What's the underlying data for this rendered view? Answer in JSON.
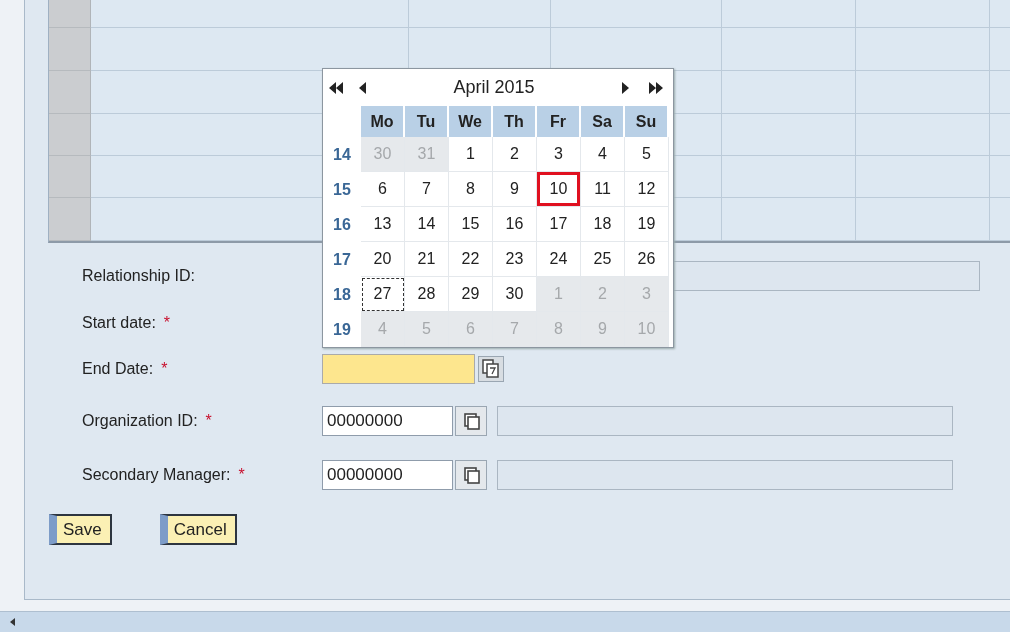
{
  "form": {
    "rows": [
      {
        "label": "Relationship ID:",
        "field": {
          "kind": "readonly"
        }
      },
      {
        "label": "Start date:",
        "required_mark": "*"
      },
      {
        "label": "End Date:",
        "required_mark": "*",
        "field": {
          "kind": "date"
        }
      },
      {
        "label": "Organization ID:",
        "required_mark": "*",
        "field": {
          "kind": "lookup",
          "value": "00000000"
        }
      },
      {
        "label": "Secondary Manager:",
        "required_mark": "*",
        "field": {
          "kind": "lookup",
          "value": "00000000"
        }
      }
    ],
    "buttons": [
      "Save",
      "Cancel"
    ]
  },
  "date_picker": {
    "title": "April 2015",
    "weekdays": [
      "Mo",
      "Tu",
      "We",
      "Th",
      "Fr",
      "Sa",
      "Su"
    ],
    "weeks": [
      {
        "number": "14",
        "days": [
          {
            "label": "30",
            "outside": true,
            "selected": false,
            "today": false
          },
          {
            "label": "31",
            "outside": true,
            "selected": false,
            "today": false
          },
          {
            "label": "1",
            "outside": false,
            "selected": false,
            "today": false
          },
          {
            "label": "2",
            "outside": false,
            "selected": false,
            "today": false
          },
          {
            "label": "3",
            "outside": false,
            "selected": false,
            "today": false
          },
          {
            "label": "4",
            "outside": false,
            "selected": false,
            "today": false
          },
          {
            "label": "5",
            "outside": false,
            "selected": false,
            "today": false
          }
        ]
      },
      {
        "number": "15",
        "days": [
          {
            "label": "6",
            "outside": false,
            "selected": false,
            "today": false
          },
          {
            "label": "7",
            "outside": false,
            "selected": false,
            "today": false
          },
          {
            "label": "8",
            "outside": false,
            "selected": false,
            "today": false
          },
          {
            "label": "9",
            "outside": false,
            "selected": false,
            "today": false
          },
          {
            "label": "10",
            "outside": false,
            "selected": true,
            "today": false
          },
          {
            "label": "11",
            "outside": false,
            "selected": false,
            "today": false
          },
          {
            "label": "12",
            "outside": false,
            "selected": false,
            "today": false
          }
        ]
      },
      {
        "number": "16",
        "days": [
          {
            "label": "13",
            "outside": false,
            "selected": false,
            "today": false
          },
          {
            "label": "14",
            "outside": false,
            "selected": false,
            "today": false
          },
          {
            "label": "15",
            "outside": false,
            "selected": false,
            "today": false
          },
          {
            "label": "16",
            "outside": false,
            "selected": false,
            "today": false
          },
          {
            "label": "17",
            "outside": false,
            "selected": false,
            "today": false
          },
          {
            "label": "18",
            "outside": false,
            "selected": false,
            "today": false
          },
          {
            "label": "19",
            "outside": false,
            "selected": false,
            "today": false
          }
        ]
      },
      {
        "number": "17",
        "days": [
          {
            "label": "20",
            "outside": false,
            "selected": false,
            "today": false
          },
          {
            "label": "21",
            "outside": false,
            "selected": false,
            "today": false
          },
          {
            "label": "22",
            "outside": false,
            "selected": false,
            "today": false
          },
          {
            "label": "23",
            "outside": false,
            "selected": false,
            "today": false
          },
          {
            "label": "24",
            "outside": false,
            "selected": false,
            "today": false
          },
          {
            "label": "25",
            "outside": false,
            "selected": false,
            "today": false
          },
          {
            "label": "26",
            "outside": false,
            "selected": false,
            "today": false
          }
        ]
      },
      {
        "number": "18",
        "days": [
          {
            "label": "27",
            "outside": false,
            "selected": false,
            "today": true
          },
          {
            "label": "28",
            "outside": false,
            "selected": false,
            "today": false
          },
          {
            "label": "29",
            "outside": false,
            "selected": false,
            "today": false
          },
          {
            "label": "30",
            "outside": false,
            "selected": false,
            "today": false
          },
          {
            "label": "1",
            "outside": true,
            "selected": false,
            "today": false
          },
          {
            "label": "2",
            "outside": true,
            "selected": false,
            "today": false
          },
          {
            "label": "3",
            "outside": true,
            "selected": false,
            "today": false
          }
        ]
      },
      {
        "number": "19",
        "days": [
          {
            "label": "4",
            "outside": true,
            "selected": false,
            "today": false
          },
          {
            "label": "5",
            "outside": true,
            "selected": false,
            "today": false
          },
          {
            "label": "6",
            "outside": true,
            "selected": false,
            "today": false
          },
          {
            "label": "7",
            "outside": true,
            "selected": false,
            "today": false
          },
          {
            "label": "8",
            "outside": true,
            "selected": false,
            "today": false
          },
          {
            "label": "9",
            "outside": true,
            "selected": false,
            "today": false
          },
          {
            "label": "10",
            "outside": true,
            "selected": false,
            "today": false
          }
        ]
      }
    ]
  }
}
